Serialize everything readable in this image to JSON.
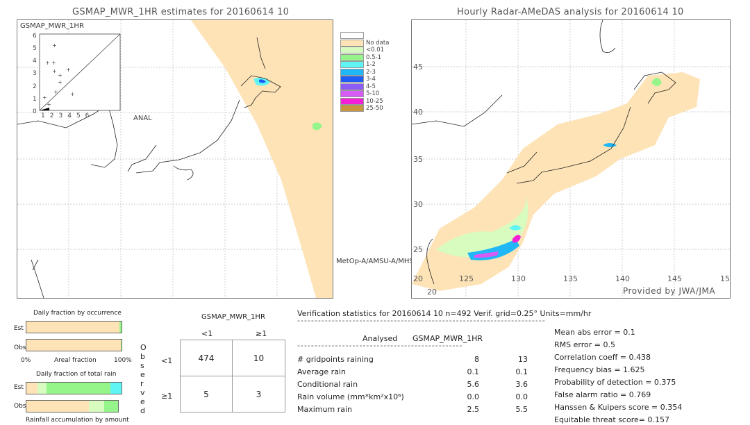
{
  "left_map": {
    "title": "GSMAP_MWR_1HR estimates for 20160614 10",
    "inset_label": "GSMAP_MWR_1HR",
    "inset_xlabel": "ANAL",
    "inset_ticks": [
      "0",
      "1",
      "2",
      "3",
      "4",
      "5",
      "6"
    ],
    "sensor_label": "MetOp-A/AMSU-A/MHS"
  },
  "right_map": {
    "title": "Hourly Radar-AMeDAS analysis for 20160614 10",
    "lon_ticks": [
      "20",
      "125",
      "130",
      "135",
      "140",
      "145",
      "15"
    ],
    "lat_ticks": [
      "45",
      "40",
      "35",
      "30",
      "25",
      "20"
    ],
    "credit": "Provided by JWA/JMA"
  },
  "legend": [
    {
      "label": "",
      "color": "#ffffff"
    },
    {
      "label": "No data",
      "color": "#fde3b5"
    },
    {
      "label": "<0.01",
      "color": "#d8fcc0"
    },
    {
      "label": "0.5-1",
      "color": "#96f58a"
    },
    {
      "label": "1-2",
      "color": "#5ff5f5"
    },
    {
      "label": "2-3",
      "color": "#1fb7f5"
    },
    {
      "label": "3-4",
      "color": "#1f5cf5"
    },
    {
      "label": "4-5",
      "color": "#8c5cf5"
    },
    {
      "label": "5-10",
      "color": "#d75cf5"
    },
    {
      "label": "10-25",
      "color": "#f51fd7"
    },
    {
      "label": "25-50",
      "color": "#c8963c"
    }
  ],
  "occurrence": {
    "title": "Daily fraction by occurrence",
    "est_label": "Est",
    "obs_label": "Obs",
    "axis_left": "0%",
    "axis_mid": "Areal fraction",
    "axis_right": "100%",
    "est_fraction_rain_pct": 2,
    "obs_fraction_rain_pct": 1
  },
  "total_rain": {
    "title": "Daily fraction of total rain",
    "est_label": "Est",
    "obs_label": "Obs",
    "footer": "Rainfall accumulation by amount"
  },
  "contingency": {
    "title": "GSMAP_MWR_1HR",
    "col_headers": [
      "<1",
      "≥1"
    ],
    "row_headers": [
      "<1",
      "≥1"
    ],
    "side_label": "Observed",
    "cells": [
      [
        "474",
        "10"
      ],
      [
        "5",
        "3"
      ]
    ]
  },
  "stats": {
    "header": "Verification statistics for 20160614 10   n=492   Verif. grid=0.25°   Units=mm/hr",
    "col1": "Analysed",
    "col2": "GSMAP_MWR_1HR",
    "rows": [
      {
        "label": "# gridpoints raining",
        "a": "8",
        "b": "13"
      },
      {
        "label": "Average rain",
        "a": "0.1",
        "b": "0.1"
      },
      {
        "label": "Conditional rain",
        "a": "5.6",
        "b": "3.6"
      },
      {
        "label": "Rain volume (mm*km²x10⁶)",
        "a": "0.0",
        "b": "0.0"
      },
      {
        "label": "Maximum rain",
        "a": "2.5",
        "b": "5.5"
      }
    ],
    "scores": [
      "Mean abs error = 0.1",
      "RMS error = 0.5",
      "Correlation coeff = 0.438",
      "Frequency bias = 1.625",
      "Probability of detection = 0.375",
      "False alarm ratio = 0.769",
      "Hanssen & Kuipers score = 0.354",
      "Equitable threat score= 0.157"
    ]
  }
}
